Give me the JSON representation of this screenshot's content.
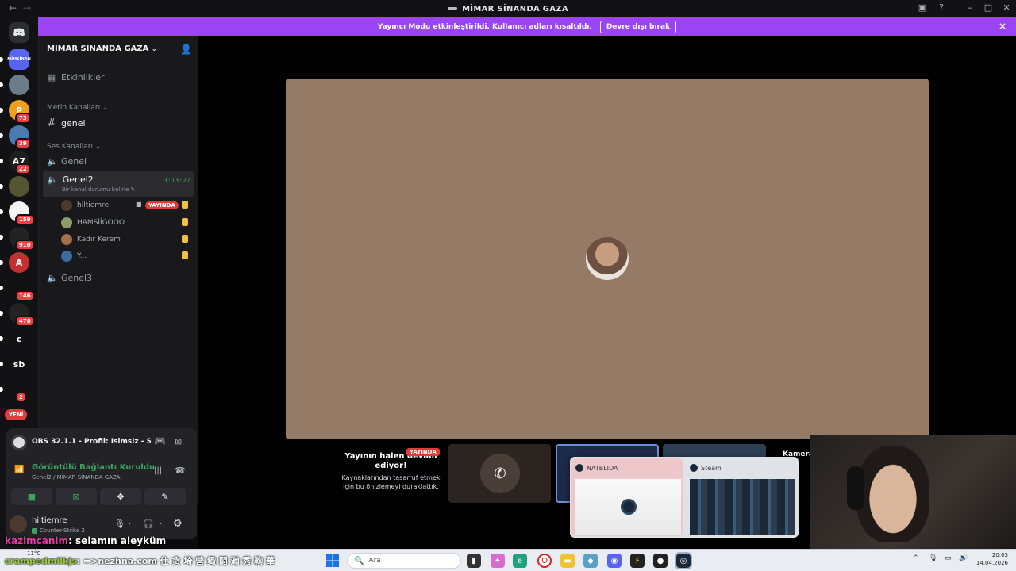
{
  "window": {
    "title": "MİMAR SİNANDA GAZA",
    "back_icon": "←",
    "forward_icon": "→"
  },
  "banner": {
    "text": "Yayıncı Modu etkinleştirildi. Kullanıcı adları kısaltıldı.",
    "button": "Devre dışı bırak",
    "close_icon": "×"
  },
  "rail": {
    "servers": [
      {
        "label": "MİMSİNAN",
        "color": "#5865f2"
      },
      {
        "label": "",
        "color": "#6b7c8a"
      },
      {
        "label": "P",
        "color": "#f0a020",
        "badge": "73"
      },
      {
        "label": "",
        "color": "#4a7ab0",
        "badge": "39"
      },
      {
        "label": "A7",
        "color": "#1e1e1e",
        "badge": "22"
      },
      {
        "label": "",
        "color": "#553"
      },
      {
        "label": "",
        "color": "#f5f5f5",
        "badge": "159"
      },
      {
        "label": "",
        "color": "#222",
        "badge": "910"
      },
      {
        "label": "A",
        "color": "#c43030"
      },
      {
        "label": "",
        "color": "#111",
        "badge": "146"
      },
      {
        "label": "",
        "color": "#222",
        "badge": "478"
      },
      {
        "label": "c",
        "color": "#121214"
      },
      {
        "label": "sb",
        "color": "#121214"
      },
      {
        "label": "",
        "color": "#121214",
        "badge": "2"
      }
    ],
    "new_badge": "YENİ"
  },
  "sidebar": {
    "server_name": "MİMAR SİNANDA GAZA",
    "events": "Etkinlikler",
    "text_category": "Metin Kanalları",
    "text_channel": "genel",
    "voice_category": "Ses Kanalları",
    "voice_channel_1": "Genel",
    "voice_channel_2": "Genel2",
    "voice_channel_2_timer": "3:13:22",
    "voice_channel_2_status": "Bir kanal durumu belirle",
    "members": [
      {
        "name": "hiltiemre",
        "live": "YAYINDA",
        "color": "#4a3a30"
      },
      {
        "name": "HAMSİİGOOO",
        "color": "#8b9c6a"
      },
      {
        "name": "Kadir Kerem",
        "color": "#a07050"
      },
      {
        "name": "Y...",
        "color": "#3a6aa0"
      }
    ],
    "voice_channel_3": "Genel3"
  },
  "voice_panel": {
    "activity_title": "OBS 32.1.1 - Profil: İsimsiz - Sa...",
    "connection_status": "Görüntülü Bağlantı Kuruldu",
    "connection_location": "Genel2 / MİMAR SİNANDA GAZA",
    "username": "hiltiemre",
    "user_activity": "Counter-Strike 2"
  },
  "stream_area": {
    "live_badge": "YAYINDA",
    "paused_title": "Yayının halen devam ediyor!",
    "paused_subtitle": "Kaynaklarından tasarruf etmek için bu önizlemeyi duraklattık.",
    "camera_label": "Kamera",
    "popup_1": "NATBLIDA",
    "popup_2": "Steam"
  },
  "chat": {
    "line1_user": "kazimcanim",
    "line1_msg": ": selamın aleyküm",
    "line2_user": "crampedmilkjs",
    "line2_msg": ": =>nezhna.com 仕 贪 埼 营 鲰 鬪 瀚 秀 鞠 華"
  },
  "taskbar": {
    "weather": "11°C",
    "search_placeholder": "Ara",
    "time": "20:03",
    "date": "14.04.2026"
  }
}
